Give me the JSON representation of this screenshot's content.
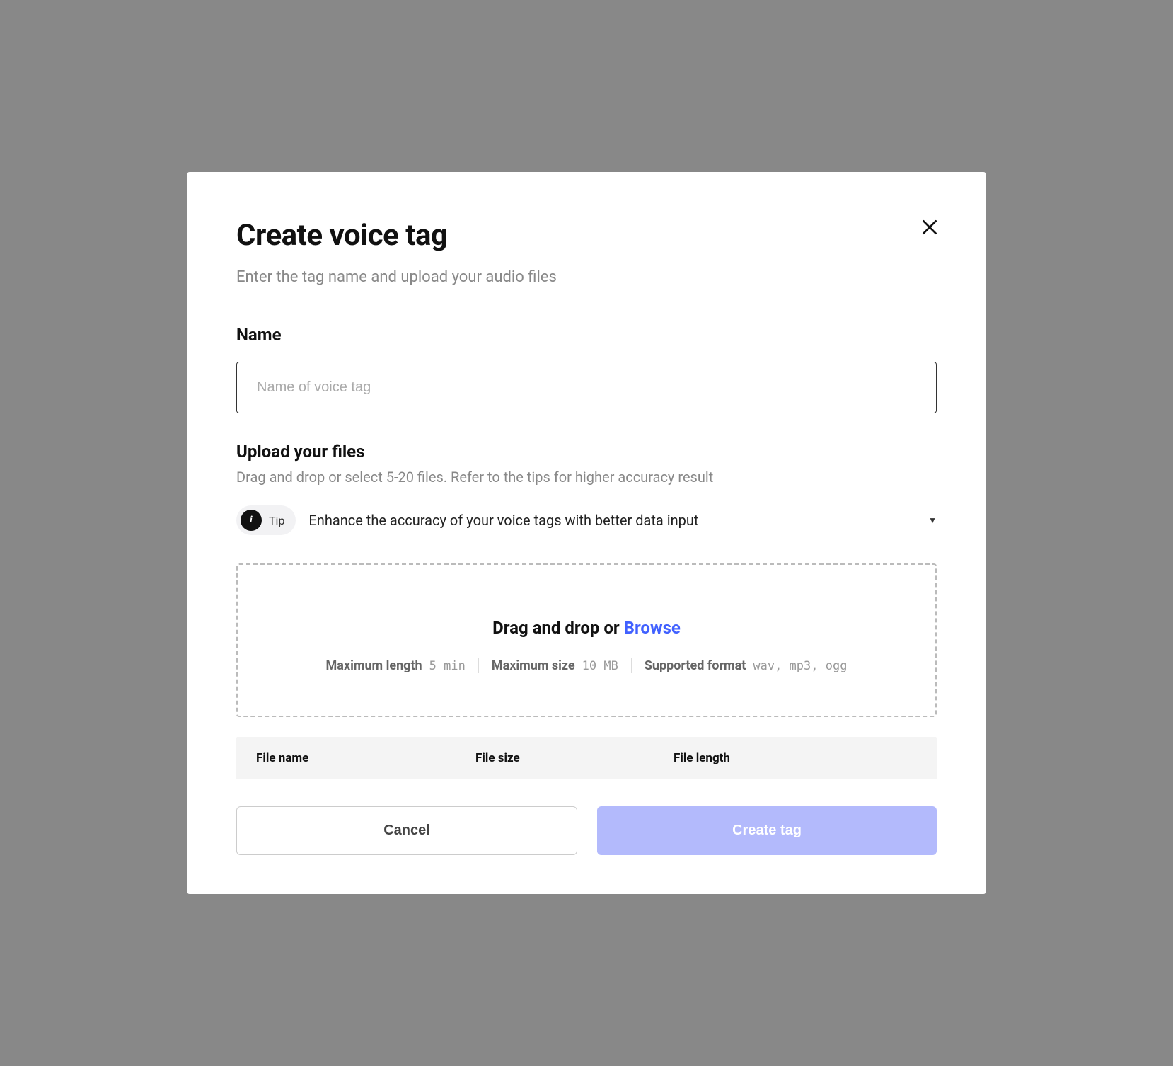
{
  "modal": {
    "title": "Create voice tag",
    "subtitle": "Enter the tag name and upload your audio files"
  },
  "name_field": {
    "label": "Name",
    "placeholder": "Name of voice tag",
    "value": ""
  },
  "upload": {
    "label": "Upload your files",
    "hint": "Drag and drop or select 5-20 files. Refer to the tips for higher accuracy result"
  },
  "tip": {
    "badge_label": "Tip",
    "text": "Enhance the accuracy of your voice tags with better data input"
  },
  "dropzone": {
    "prefix": "Drag and drop or ",
    "browse": "Browse",
    "meta": {
      "max_length_label": "Maximum length",
      "max_length_value": "5 min",
      "max_size_label": "Maximum size",
      "max_size_value": "10 MB",
      "format_label": "Supported format",
      "format_value": "wav, mp3, ogg"
    }
  },
  "file_table": {
    "col_name": "File name",
    "col_size": "File size",
    "col_length": "File length"
  },
  "buttons": {
    "cancel": "Cancel",
    "create": "Create tag"
  }
}
